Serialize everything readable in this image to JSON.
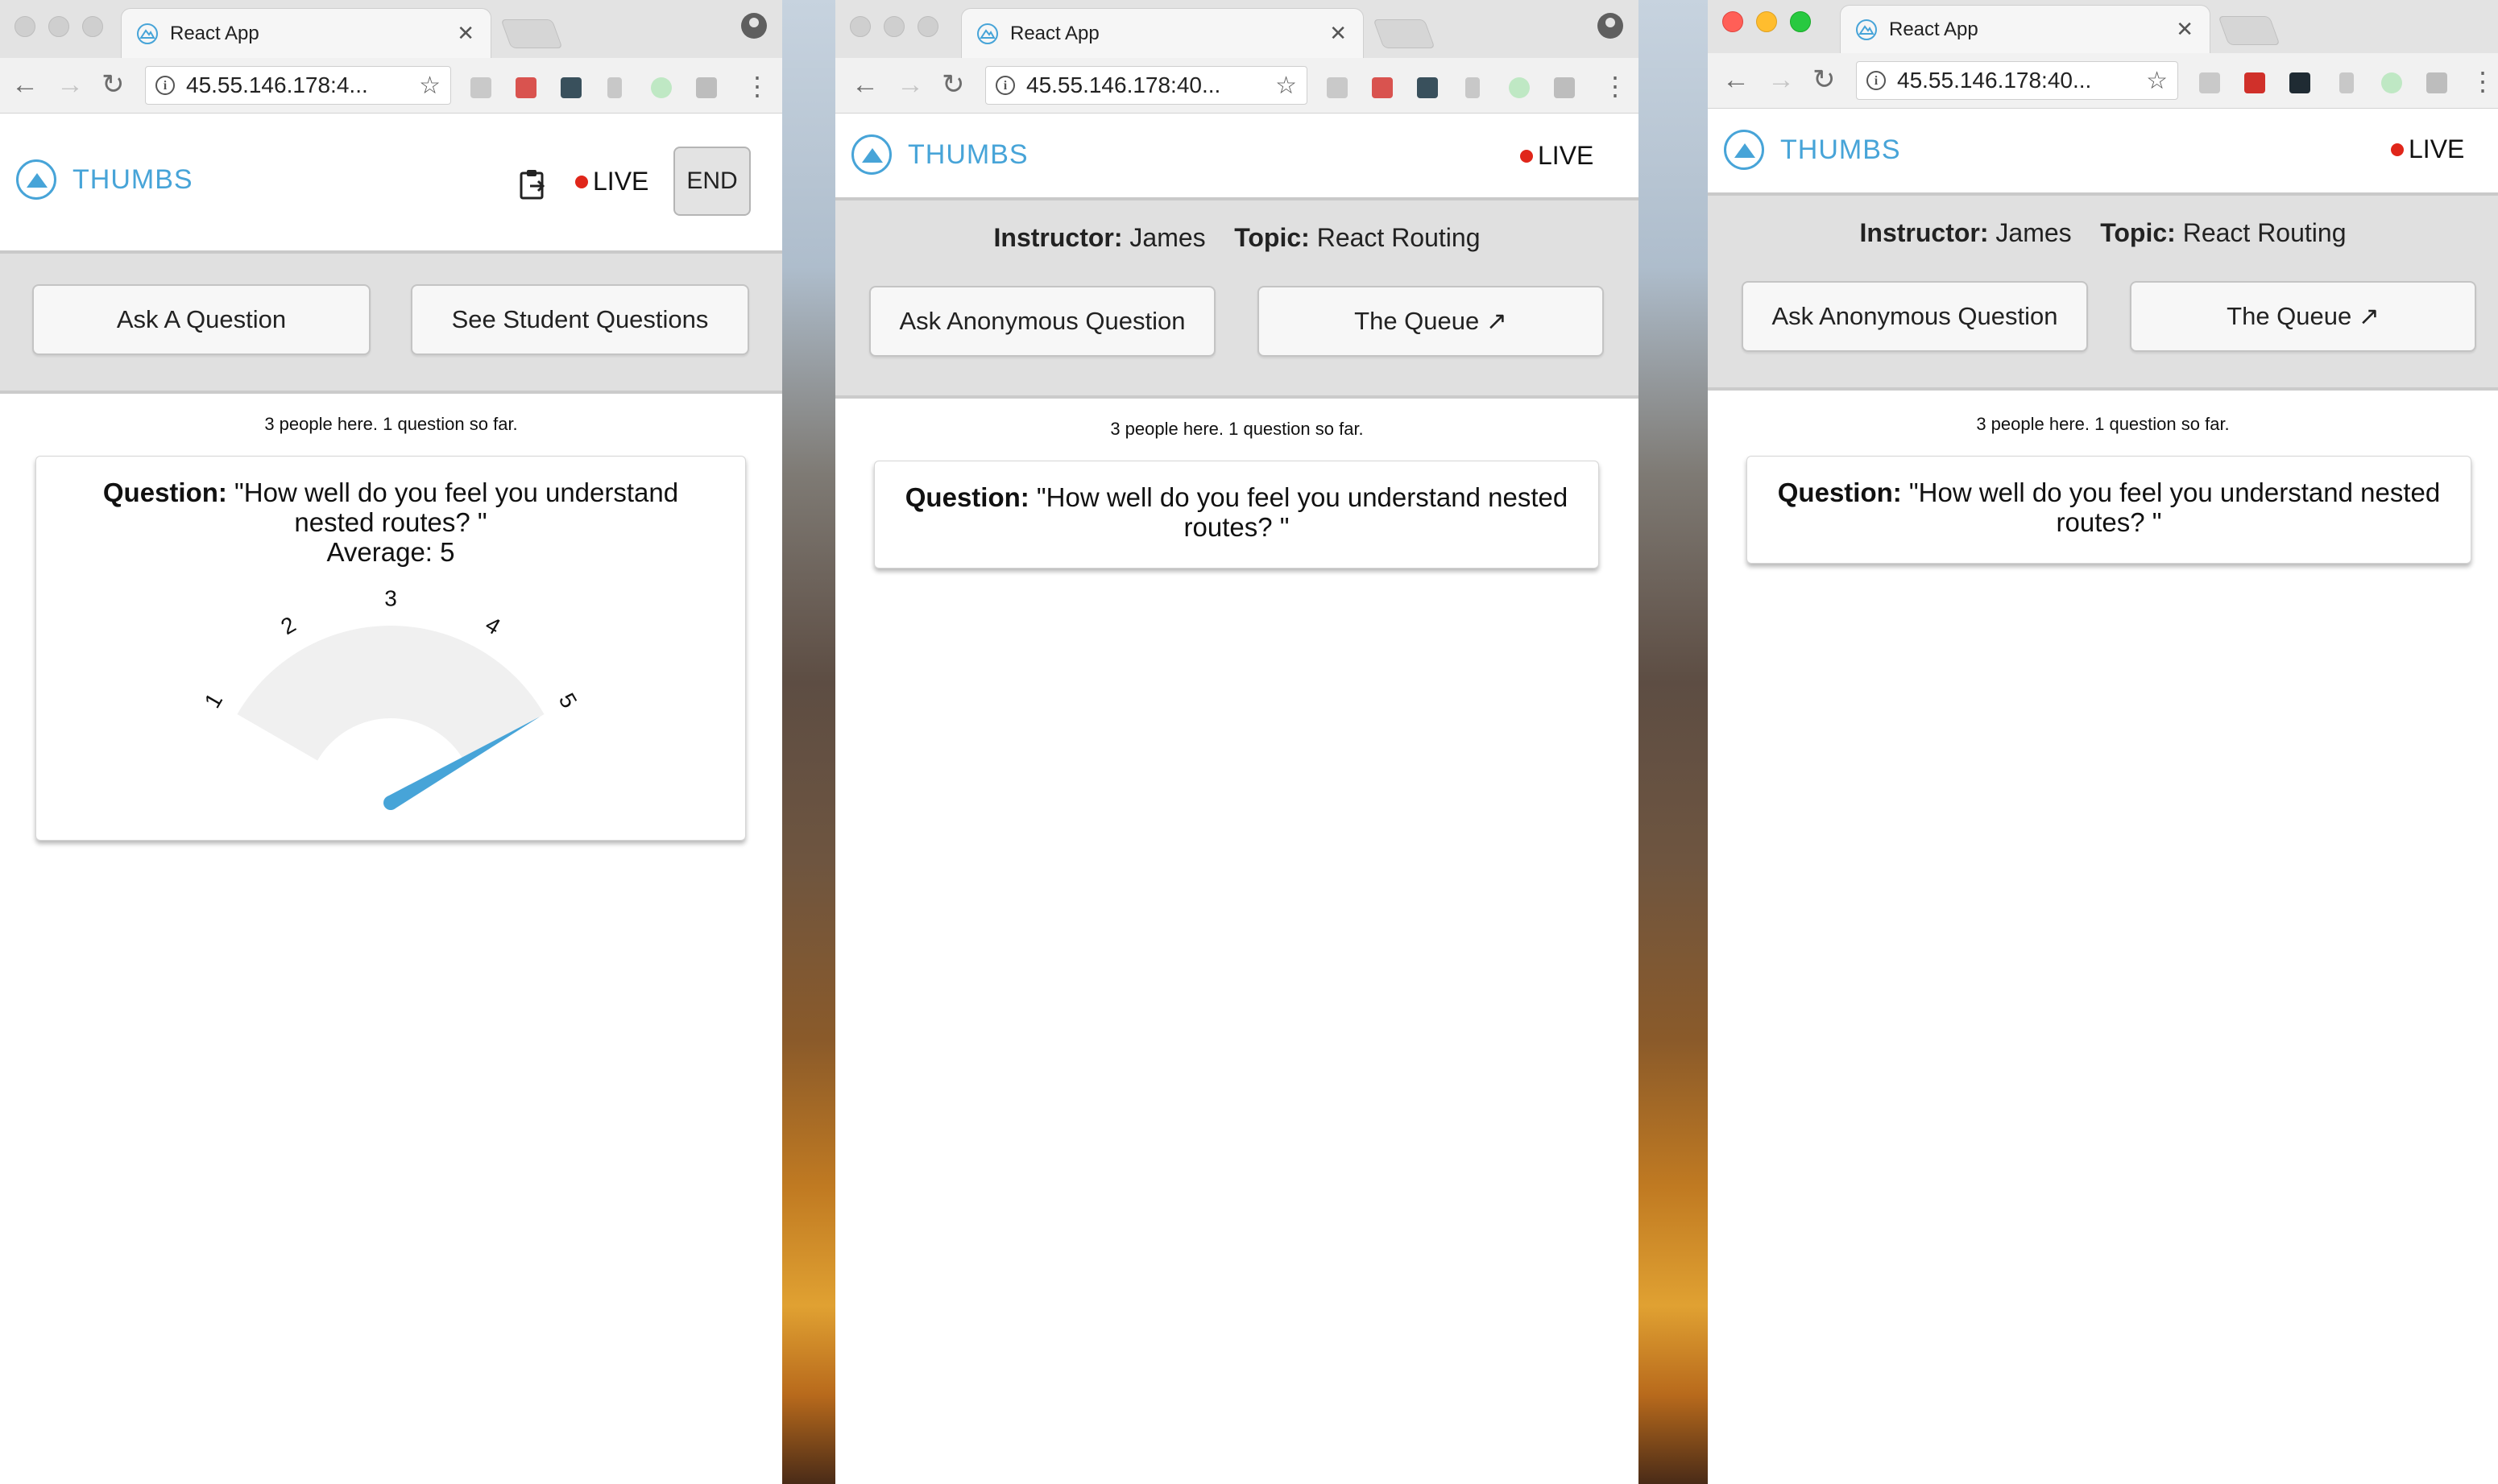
{
  "windows": [
    {
      "tab_title": "React App",
      "url": "45.55.146.178:4...",
      "brand": "THUMBS",
      "live_label": "LIVE",
      "end_label": "END",
      "buttons": [
        "Ask A Question",
        "See Student Questions"
      ],
      "count_text": "3 people here. 1 question so far.",
      "question_label": "Question:",
      "question_text": " \"How well do you feel you understand nested routes? \"",
      "average_label": "Average:",
      "average_value": "5",
      "gauge": {
        "min": 1,
        "max": 5,
        "value": 5,
        "ticks": [
          "1",
          "2",
          "3",
          "4",
          "5"
        ]
      }
    },
    {
      "tab_title": "React App",
      "url": "45.55.146.178:40...",
      "brand": "THUMBS",
      "live_label": "LIVE",
      "instructor_label": "Instructor:",
      "instructor_name": "James",
      "topic_label": "Topic:",
      "topic_name": "React Routing",
      "buttons": [
        "Ask Anonymous Question",
        "The Queue ↗"
      ],
      "count_text": "3 people here. 1 question so far.",
      "question_label": "Question:",
      "question_text": " \"How well do you feel you understand nested routes? \""
    },
    {
      "tab_title": "React App",
      "url": "45.55.146.178:40...",
      "brand": "THUMBS",
      "live_label": "LIVE",
      "instructor_label": "Instructor:",
      "instructor_name": "James",
      "topic_label": "Topic:",
      "topic_name": "React Routing",
      "buttons": [
        "Ask Anonymous Question",
        "The Queue ↗"
      ],
      "count_text": "3 people here. 1 question so far.",
      "question_label": "Question:",
      "question_text": " \"How well do you feel you understand nested routes? \""
    }
  ],
  "colors": {
    "brand": "#47a4d8",
    "live_dot": "#e0261a",
    "gauge_fill": "#f0f0f0",
    "needle": "#47a4d8"
  }
}
